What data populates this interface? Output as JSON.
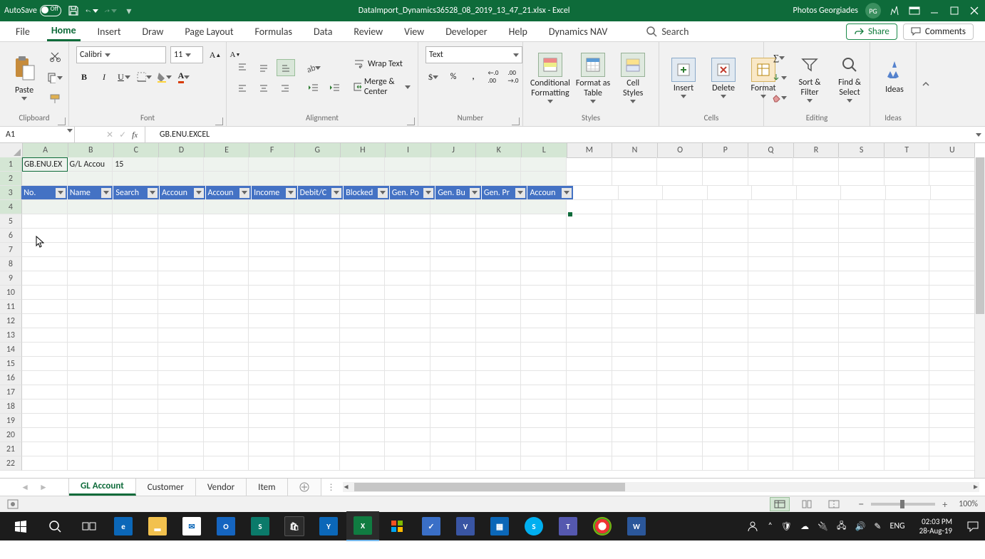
{
  "titlebar": {
    "autosave_label": "AutoSave",
    "autosave_state": "Off",
    "filename": "DataImport_Dynamics36528_08_2019_13_47_21.xlsx  -  Excel",
    "user": "Photos Georgiades",
    "user_initials": "PG"
  },
  "tabs": {
    "file": "File",
    "home": "Home",
    "insert": "Insert",
    "draw": "Draw",
    "page": "Page Layout",
    "formulas": "Formulas",
    "data": "Data",
    "review": "Review",
    "view": "View",
    "developer": "Developer",
    "help": "Help",
    "nav": "Dynamics NAV",
    "search": "Search"
  },
  "share": {
    "share": "Share",
    "comments": "Comments"
  },
  "ribbon": {
    "clipboard": {
      "label": "Clipboard",
      "paste": "Paste"
    },
    "font": {
      "label": "Font",
      "name": "Calibri",
      "size": "11"
    },
    "alignment": {
      "label": "Alignment",
      "wrap": "Wrap Text",
      "merge": "Merge & Center"
    },
    "number": {
      "label": "Number",
      "format": "Text"
    },
    "styles": {
      "label": "Styles",
      "cond": "Conditional\nFormatting",
      "fmt": "Format as\nTable",
      "cell": "Cell\nStyles"
    },
    "cells": {
      "label": "Cells",
      "ins": "Insert",
      "del": "Delete",
      "form": "Format"
    },
    "editing": {
      "label": "Editing",
      "sort": "Sort &\nFilter",
      "find": "Find &\nSelect"
    },
    "ideas": {
      "label": "Ideas",
      "ideas": "Ideas"
    }
  },
  "namebox": "A1",
  "formula": "GB.ENU.EXCEL",
  "columns": [
    "A",
    "B",
    "C",
    "D",
    "E",
    "F",
    "G",
    "H",
    "I",
    "J",
    "K",
    "L",
    "M",
    "N",
    "O",
    "P",
    "Q",
    "R",
    "S",
    "T",
    "U"
  ],
  "rowcount": 22,
  "row1": {
    "A": "GB.ENU.EX",
    "B": "G/L Accou",
    "C": "15"
  },
  "table_headers": [
    "No.",
    "Name",
    "Search",
    "Accoun",
    "Accoun",
    "Income",
    "Debit/C",
    "Blocked",
    "Gen. Po",
    "Gen. Bu",
    "Gen. Pr",
    "Accoun"
  ],
  "sheets": {
    "active": "GL Account",
    "others": [
      "Customer",
      "Vendor",
      "Item"
    ]
  },
  "status": {
    "zoom": "100%"
  },
  "taskbar": {
    "lang": "ENG",
    "time": "02:03 PM",
    "date": "28-Aug-19"
  }
}
